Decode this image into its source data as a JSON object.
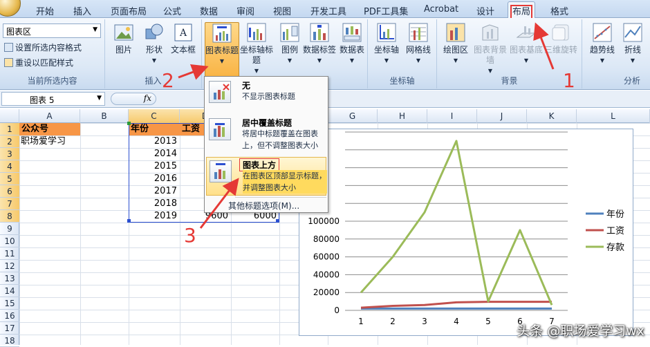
{
  "tabs": [
    "开始",
    "插入",
    "页面布局",
    "公式",
    "数据",
    "审阅",
    "视图",
    "开发工具",
    "PDF工具集",
    "Acrobat",
    "设计",
    "布局",
    "格式"
  ],
  "ribbon": {
    "selection_dropdown": "图表区",
    "format_selection": "设置所选内容格式",
    "reset_style": "重设以匹配样式",
    "group_current_selection": "当前所选内容",
    "insert": {
      "picture": "图片",
      "shapes": "形状",
      "textbox": "文本框",
      "group": "插入"
    },
    "labels": {
      "chart_title": "图表标题",
      "axis_titles": "坐标轴标题",
      "legend": "图例",
      "data_labels": "数据标签",
      "data_table": "数据表"
    },
    "axes": {
      "axes": "坐标轴",
      "gridlines": "网格线",
      "group": "坐标轴"
    },
    "background": {
      "plot_area": "绘图区",
      "chart_wall": "图表背景墙",
      "chart_floor": "图表基底",
      "rotation_3d": "三维旋转",
      "group": "背景"
    },
    "analysis": {
      "trendline": "趋势线",
      "lines": "折线",
      "group": "分析"
    }
  },
  "formula_bar": {
    "name_box": "图表 5",
    "fx": "fx"
  },
  "columns": [
    "A",
    "B",
    "C",
    "D",
    "E",
    "F",
    "G",
    "H",
    "I",
    "J",
    "K",
    "L"
  ],
  "rows": [
    "1",
    "2",
    "3",
    "4",
    "5",
    "6",
    "7",
    "8",
    "9",
    "10",
    "11",
    "12",
    "13",
    "14",
    "15",
    "16",
    "17",
    "18"
  ],
  "cells": {
    "a1": "公众号",
    "a2": "职场爱学习",
    "c1": "年份",
    "d1": "工资",
    "years": [
      "2013",
      "2014",
      "2015",
      "2016",
      "2017",
      "2018",
      "2019"
    ],
    "d8": "9600",
    "e8": "6000"
  },
  "menu": {
    "none_title": "无",
    "none_desc": "不显示图表标题",
    "overlay_title": "居中覆盖标题",
    "overlay_desc": "将居中标题覆盖在图表上，但不调整图表大小",
    "above_title": "图表上方",
    "above_desc": "在图表区顶部显示标题，并调整图表大小",
    "more": "其他标题选项(M)..."
  },
  "annotations": {
    "step1": "1",
    "step2": "2",
    "step3": "3"
  },
  "watermark": "头条 @职场爱学习wx",
  "colors": {
    "accent_red": "#e53935",
    "header_orange": "#f79646",
    "year_series": "#4f81bd",
    "wage_series": "#c0504d",
    "savings_series": "#9bbb59"
  },
  "chart_data": {
    "type": "line",
    "x": [
      1,
      2,
      3,
      4,
      5,
      6,
      7
    ],
    "series": [
      {
        "name": "年份",
        "values": [
          2013,
          2014,
          2015,
          2016,
          2017,
          2018,
          2019
        ]
      },
      {
        "name": "工资",
        "values": [
          3000,
          5000,
          6000,
          9000,
          9600,
          9600,
          9600
        ]
      },
      {
        "name": "存款",
        "values": [
          20000,
          60000,
          110000,
          190000,
          10000,
          90000,
          6000
        ]
      }
    ],
    "y_ticks": [
      "0",
      "20000",
      "40000",
      "60000",
      "80000",
      "100000"
    ],
    "x_ticks": [
      "1",
      "2",
      "3",
      "4",
      "5",
      "6",
      "7"
    ],
    "ylim": [
      0,
      200000
    ],
    "legend_position": "right",
    "grid": true
  }
}
